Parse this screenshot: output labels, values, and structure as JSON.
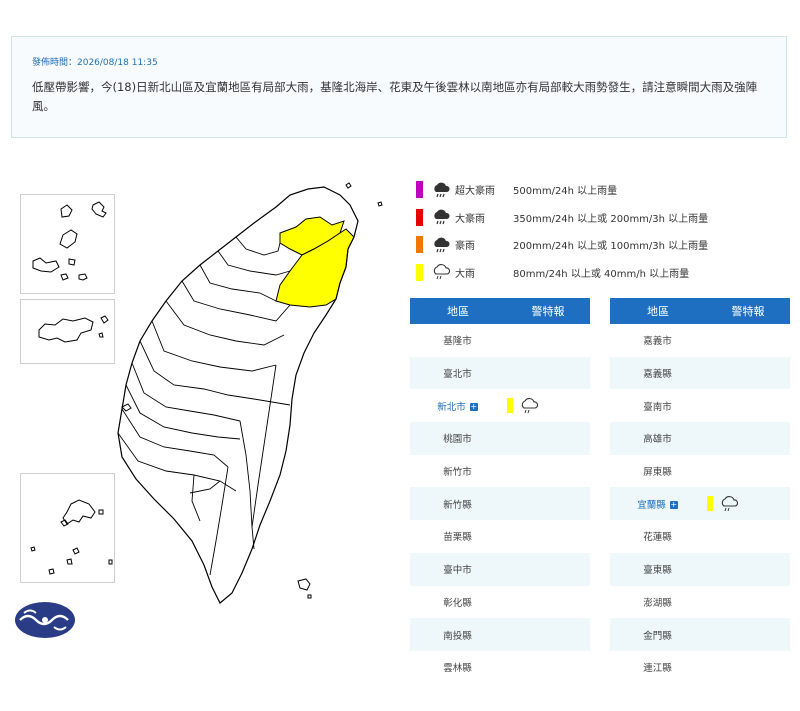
{
  "notice": {
    "time": "發佈時間：2026/08/18 11:35",
    "message": "低壓帶影響，今(18)日新北山區及宜蘭地區有局部大雨，基隆北海岸、花東及午後雲林以南地區亦有局部較大雨勢發生，請注意瞬間大雨及強陣風。"
  },
  "legend": [
    {
      "name": "超大豪雨",
      "desc": "500mm/24h 以上雨量",
      "color": "#c000c0",
      "icon": "heavy-rain-cloud-icon"
    },
    {
      "name": "大豪雨",
      "desc": "350mm/24h 以上或 200mm/3h 以上雨量",
      "color": "#e60000",
      "icon": "heavy-rain-cloud-icon"
    },
    {
      "name": "豪雨",
      "desc": "200mm/24h 以上或 100mm/3h 以上雨量",
      "color": "#f07800",
      "icon": "heavy-rain-cloud-icon"
    },
    {
      "name": "大雨",
      "desc": "80mm/24h 以上或 40mm/h 以上雨量",
      "color": "#ffff00",
      "icon": "rain-cloud-icon"
    }
  ],
  "table_left": {
    "header_area": "地區",
    "header_warn": "警特報",
    "rows": [
      {
        "area": "基隆市",
        "warn": false
      },
      {
        "area": "臺北市",
        "warn": false
      },
      {
        "area": "新北市",
        "warn": true
      },
      {
        "area": "桃園市",
        "warn": false
      },
      {
        "area": "新竹市",
        "warn": false
      },
      {
        "area": "新竹縣",
        "warn": false
      },
      {
        "area": "苗栗縣",
        "warn": false
      },
      {
        "area": "臺中市",
        "warn": false
      },
      {
        "area": "彰化縣",
        "warn": false
      },
      {
        "area": "南投縣",
        "warn": false
      },
      {
        "area": "雲林縣",
        "warn": false
      }
    ]
  },
  "table_right": {
    "header_area": "地區",
    "header_warn": "警特報",
    "rows": [
      {
        "area": "嘉義市",
        "warn": false
      },
      {
        "area": "嘉義縣",
        "warn": false
      },
      {
        "area": "臺南市",
        "warn": false
      },
      {
        "area": "高雄市",
        "warn": false
      },
      {
        "area": "屏東縣",
        "warn": false
      },
      {
        "area": "宜蘭縣",
        "warn": true
      },
      {
        "area": "花蓮縣",
        "warn": false
      },
      {
        "area": "臺東縣",
        "warn": false
      },
      {
        "area": "澎湖縣",
        "warn": false
      },
      {
        "area": "金門縣",
        "warn": false
      },
      {
        "area": "連江縣",
        "warn": false
      }
    ]
  },
  "colors": {
    "header_blue": "#1e6fc1",
    "warning_yellow": "#ffff00",
    "row_alt": "#eef7fa"
  }
}
